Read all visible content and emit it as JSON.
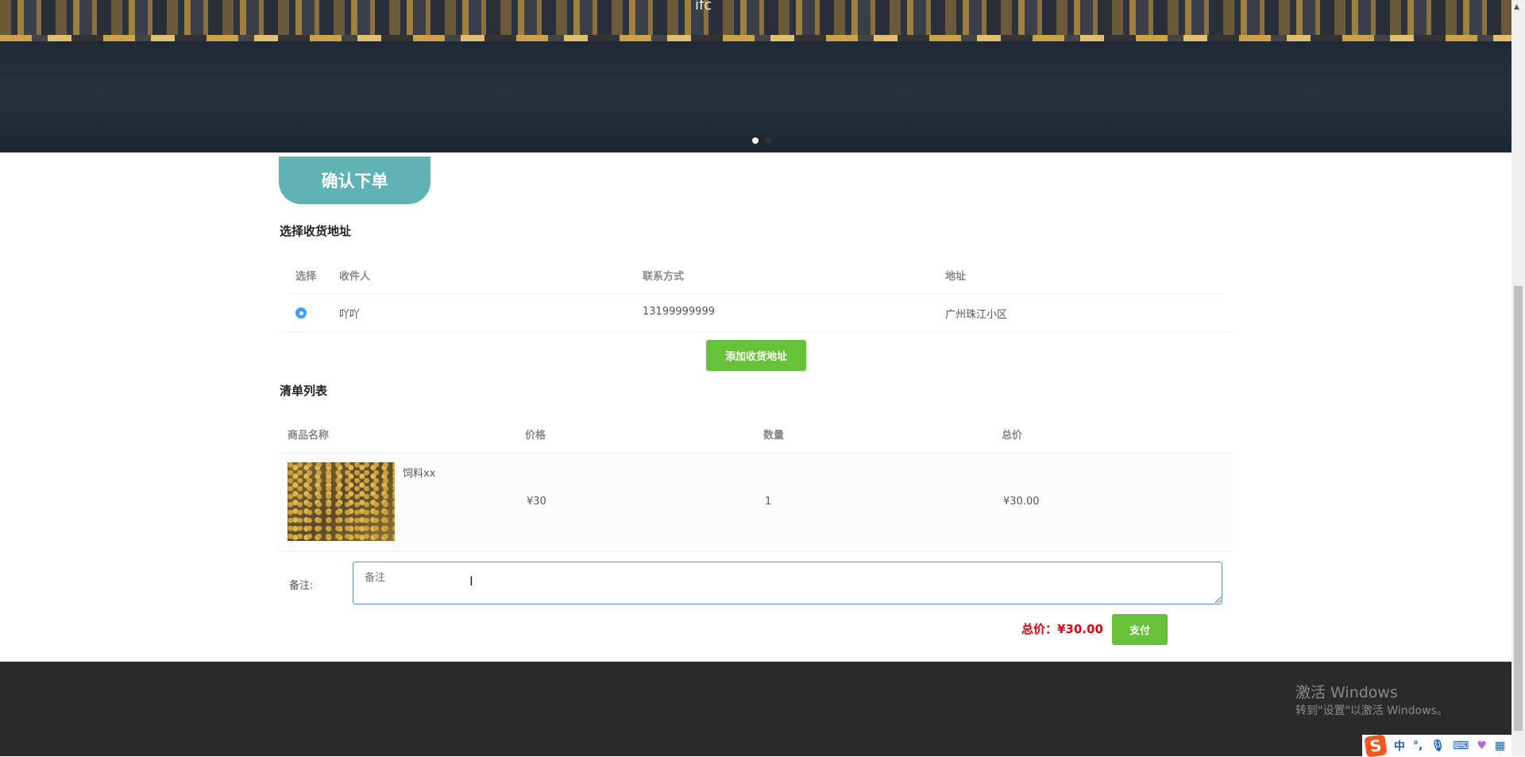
{
  "banner": {
    "logo_text": "ifc",
    "slides": 2,
    "active_slide": 1
  },
  "page_title": "确认下单",
  "address_section": {
    "title": "选择收货地址",
    "headers": [
      "选择",
      "收件人",
      "联系方式",
      "地址"
    ],
    "rows": [
      {
        "selected": true,
        "name": "吖吖",
        "phone": "13199999999",
        "address": "广州珠江小区"
      }
    ],
    "add_button": "添加收货地址"
  },
  "order_section": {
    "title": "清单列表",
    "headers": [
      "商品名称",
      "价格",
      "数量",
      "总价"
    ],
    "items": [
      {
        "name": "饲料xx",
        "price": "¥30",
        "quantity": "1",
        "subtotal": "¥30.00"
      }
    ]
  },
  "remark": {
    "label": "备注:",
    "placeholder": "备注",
    "value": ""
  },
  "total": {
    "text": "总价：¥30.00"
  },
  "pay_button": "支付",
  "watermark": {
    "title": "激活 Windows",
    "subtitle": "转到\"设置\"以激活 Windows。"
  },
  "ime": {
    "logo": "S",
    "mode": "中",
    "punct": "°,"
  }
}
